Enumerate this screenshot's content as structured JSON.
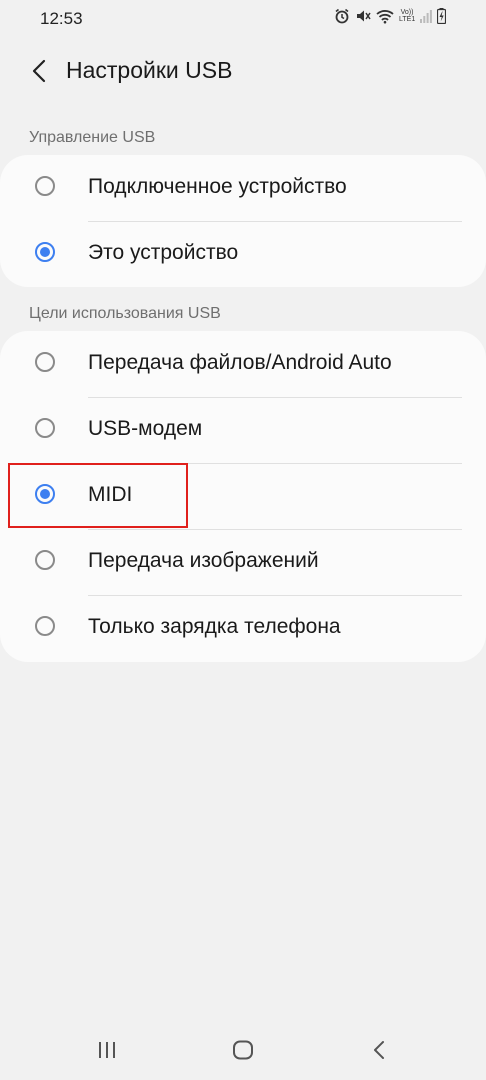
{
  "status_bar": {
    "time": "12:53",
    "icons": [
      "alarm-icon",
      "mute-icon",
      "wifi-icon",
      "volte-icon",
      "signal-icon",
      "battery-charging-icon"
    ],
    "volte_text": "Vo)) LTE1"
  },
  "header": {
    "title": "Настройки USB"
  },
  "usb_control": {
    "label": "Управление USB",
    "options": [
      {
        "label": "Подключенное устройство",
        "selected": false
      },
      {
        "label": "Это устройство",
        "selected": true
      }
    ]
  },
  "usb_purpose": {
    "label": "Цели использования USB",
    "options": [
      {
        "label": "Передача файлов/Android Auto",
        "selected": false
      },
      {
        "label": "USB-модем",
        "selected": false
      },
      {
        "label": "MIDI",
        "selected": true
      },
      {
        "label": "Передача изображений",
        "selected": false
      },
      {
        "label": "Только зарядка телефона",
        "selected": false
      }
    ]
  },
  "nav_bar": {
    "buttons": [
      "recent-apps-icon",
      "home-icon",
      "back-icon"
    ]
  },
  "colors": {
    "accent": "#3d7ff0",
    "highlight": "#e0201c",
    "background": "#f1f1f1",
    "card": "#fbfbfb"
  }
}
